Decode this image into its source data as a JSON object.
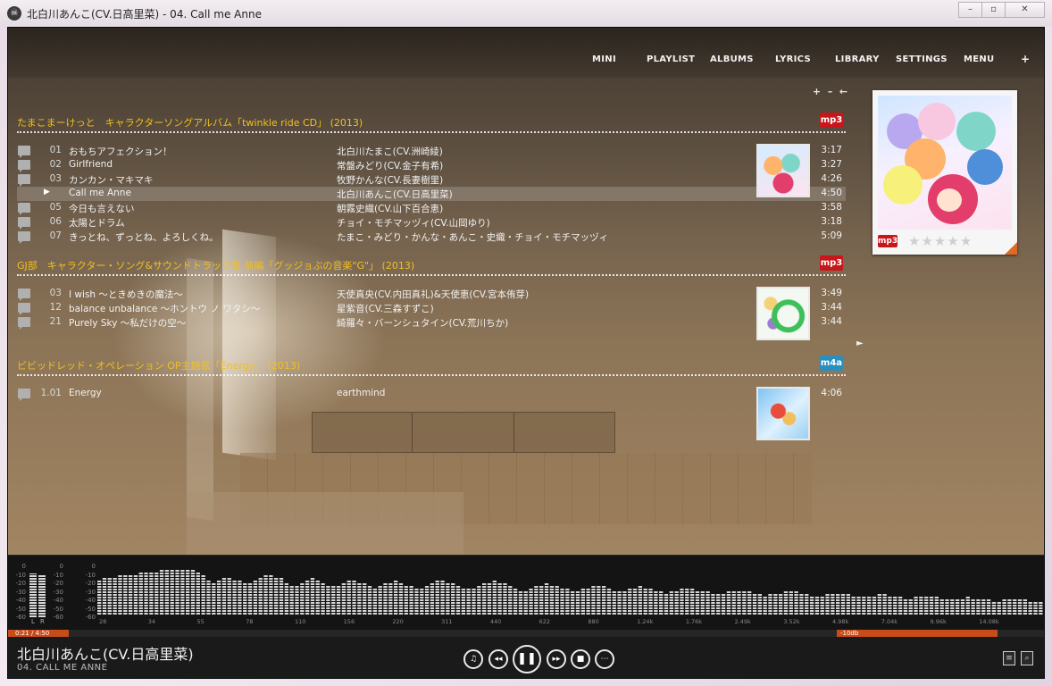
{
  "window": {
    "title": "北白川あんこ(CV.日高里菜) - 04. Call me Anne",
    "app_icon": "☠",
    "buttons": {
      "minimize": "–",
      "maximize": "▫",
      "close": "✕"
    }
  },
  "nav": [
    "MINI",
    "PLAYLIST",
    "ALBUMS",
    "LYRICS",
    "LIBRARY",
    "SETTINGS",
    "MENU",
    "+"
  ],
  "list_tools": [
    "+",
    "–",
    "←"
  ],
  "albums": [
    {
      "title": "たまこまーけっと　キャラクターソングアルバム「twinkle ride CD」 (2013)",
      "format": "mp3",
      "format_color": "#c8161b",
      "tracks": [
        {
          "num": "01",
          "title": "おもちアフェクション！",
          "artist": "北白川たまこ(CV.洲崎綾)",
          "duration": "3:17"
        },
        {
          "num": "02",
          "title": "Girlfriend",
          "artist": "常盤みどり(CV.金子有希)",
          "duration": "3:27"
        },
        {
          "num": "03",
          "title": "カンカン・マキマキ",
          "artist": "牧野かんな(CV.長妻樹里)",
          "duration": "4:26"
        },
        {
          "num": "04",
          "title": "Call me Anne",
          "artist": "北白川あんこ(CV.日高里菜)",
          "duration": "4:50",
          "playing": true
        },
        {
          "num": "05",
          "title": "今日も言えない",
          "artist": "朝霧史織(CV.山下百合恵)",
          "duration": "3:58"
        },
        {
          "num": "06",
          "title": "太陽とドラム",
          "artist": "チョイ・モチマッヅィ(CV.山岡ゆり)",
          "duration": "3:18"
        },
        {
          "num": "07",
          "title": "きっとね、ずっとね、よろしくね。",
          "artist": "たまこ・みどり・かんな・あんこ・史織・チョイ・モチマッヅィ",
          "duration": "5:09"
        }
      ]
    },
    {
      "title": "GJ部　キャラクター・ソング&サウンドトラック集 前編「グッジョぶの音楽\"G\"」 (2013)",
      "format": "mp3",
      "format_color": "#c8161b",
      "tracks": [
        {
          "num": "03",
          "title": "I wish ～ときめきの魔法～",
          "artist": "天使真央(CV.内田真礼)&天使恵(CV.宮本侑芽)",
          "duration": "3:49"
        },
        {
          "num": "12",
          "title": "balance unbalance ～ホントウ ノ ワタシ～",
          "artist": "星紫音(CV.三森すずこ)",
          "duration": "3:44"
        },
        {
          "num": "21",
          "title": "Purely Sky ～私だけの空～",
          "artist": "綺羅々・バーンシュタイン(CV.荒川ちか)",
          "duration": "3:44"
        }
      ]
    },
    {
      "title": "ビビッドレッド・オペレーション OP主題歌「Energy」 (2013)",
      "format": "m4a",
      "format_color": "#2a8fbf",
      "tracks": [
        {
          "num": "1.01",
          "title": "Energy",
          "artist": "earthmind",
          "duration": "4:06"
        }
      ]
    }
  ],
  "cover": {
    "format": "mp3",
    "rating": 0,
    "rating_max": 5,
    "accent": "#e06a24"
  },
  "spectrum": {
    "db_scale": [
      "0",
      "-10",
      "-20",
      "-30",
      "-40",
      "-50",
      "-60"
    ],
    "vu_labels": [
      "L",
      "R"
    ],
    "vu_levels": [
      0.88,
      0.86
    ],
    "freq_labels": [
      "28",
      "34",
      "55",
      "78",
      "110",
      "156",
      "220",
      "311",
      "440",
      "622",
      "880",
      "1.24k",
      "1.76k",
      "2.49k",
      "3.52k",
      "4.98k",
      "7.04k",
      "9.96k",
      "14.08k"
    ],
    "levels": [
      0.62,
      0.64,
      0.66,
      0.66,
      0.69,
      0.71,
      0.72,
      0.72,
      0.74,
      0.75,
      0.76,
      0.77,
      0.79,
      0.8,
      0.8,
      0.81,
      0.82,
      0.8,
      0.79,
      0.76,
      0.7,
      0.62,
      0.58,
      0.6,
      0.64,
      0.67,
      0.63,
      0.6,
      0.57,
      0.58,
      0.62,
      0.66,
      0.7,
      0.72,
      0.68,
      0.64,
      0.58,
      0.54,
      0.52,
      0.55,
      0.6,
      0.64,
      0.62,
      0.58,
      0.54,
      0.5,
      0.52,
      0.56,
      0.6,
      0.62,
      0.58,
      0.55,
      0.5,
      0.48,
      0.52,
      0.56,
      0.58,
      0.6,
      0.56,
      0.54,
      0.5,
      0.46,
      0.48,
      0.52,
      0.57,
      0.6,
      0.62,
      0.58,
      0.55,
      0.52,
      0.48,
      0.45,
      0.48,
      0.5,
      0.55,
      0.58,
      0.6,
      0.57,
      0.55,
      0.5,
      0.46,
      0.44,
      0.42,
      0.46,
      0.5,
      0.54,
      0.56,
      0.53,
      0.5,
      0.48,
      0.46,
      0.44,
      0.42,
      0.45,
      0.48,
      0.5,
      0.52,
      0.5,
      0.47,
      0.44,
      0.4,
      0.42,
      0.45,
      0.48,
      0.5,
      0.47,
      0.45,
      0.42,
      0.4,
      0.38,
      0.4,
      0.44,
      0.46,
      0.48,
      0.46,
      0.44,
      0.42,
      0.4,
      0.38,
      0.36,
      0.38,
      0.4,
      0.42,
      0.44,
      0.42,
      0.4,
      0.38,
      0.36,
      0.34,
      0.35,
      0.36,
      0.38,
      0.4,
      0.42,
      0.4,
      0.38,
      0.36,
      0.34,
      0.32,
      0.34,
      0.36,
      0.38,
      0.39,
      0.37,
      0.35,
      0.33,
      0.31,
      0.3,
      0.32,
      0.34,
      0.35,
      0.36,
      0.34,
      0.32,
      0.3,
      0.29,
      0.28,
      0.3,
      0.32,
      0.33,
      0.32,
      0.3,
      0.28,
      0.27,
      0.26,
      0.28,
      0.29,
      0.3,
      0.29,
      0.27,
      0.26,
      0.25,
      0.24,
      0.23,
      0.25,
      0.26,
      0.27,
      0.26,
      0.25,
      0.24,
      0.23,
      0.22
    ],
    "position_left": "0:21 / 4:50",
    "position_right": "-10db"
  },
  "now_playing": {
    "artist": "北白川あんこ(CV.日高里菜)",
    "title": "04. CALL ME ANNE"
  },
  "controls": {
    "music_icon": "♫",
    "rewind_icon": "◂◂",
    "pause_icon": "❚❚",
    "forward_icon": "▸▸",
    "stop_icon": "■",
    "queue_icon": "⋯"
  },
  "side_arrow": "►"
}
